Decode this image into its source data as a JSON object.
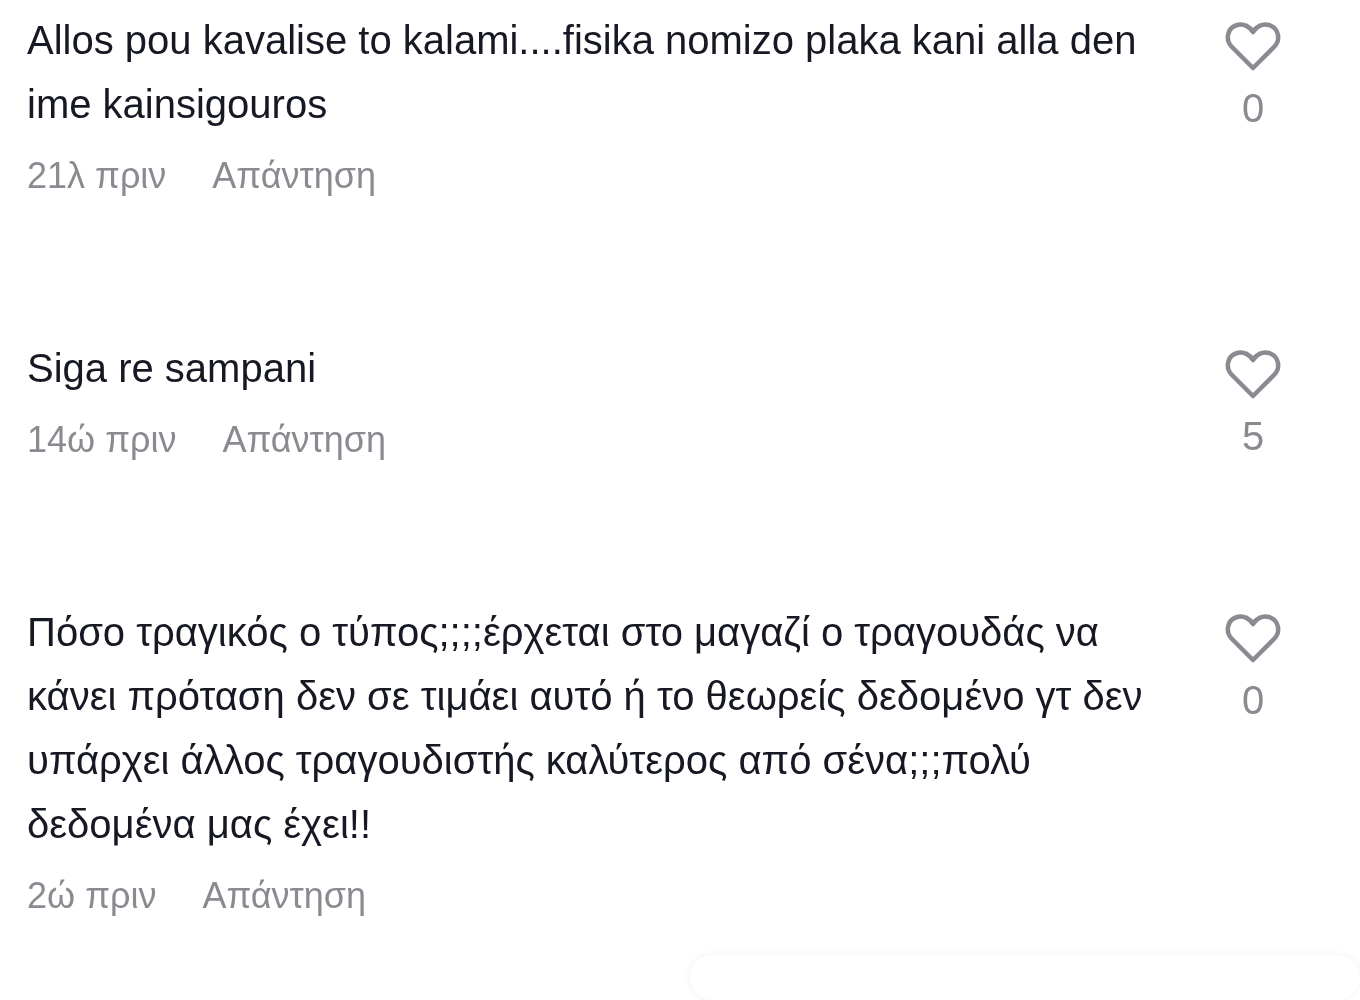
{
  "comments": [
    {
      "text": "Allos pou kavalise to kalami....fisika nomizo plaka kani alla den ime kainsigouros",
      "time": "21λ πριν",
      "reply": "Απάντηση",
      "likes": "0",
      "liked": false
    },
    {
      "text": "Siga re sampani",
      "time": "14ώ πριν",
      "reply": "Απάντηση",
      "likes": "5",
      "liked": false
    },
    {
      "text": "Πόσο τραγικός ο τύπος;;;;έρχεται στο μαγαζί ο τραγουδάς να κάνει πρόταση δεν σε τιμάει αυτό ή το θεωρείς δεδομένο γτ δεν υπάρχει άλλος τραγουδιστής καλύτερος από σένα;;;πολύ δεδομένα μας έχει!!",
      "time": "2ώ πριν",
      "reply": "Απάντηση",
      "likes": "0",
      "liked": false
    }
  ]
}
